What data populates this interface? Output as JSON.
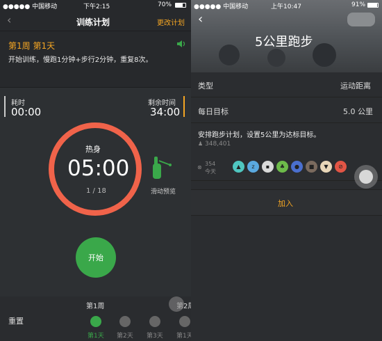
{
  "left": {
    "status": {
      "carrier": "●●●●● 中国移动",
      "time": "下午2:15",
      "battery": "70%"
    },
    "nav": {
      "title": "训练计划",
      "action": "更改计划"
    },
    "plan": {
      "week_day": "第1周 第1天",
      "desc": "开始训练，慢跑1分钟+步行2分钟，重复8次。"
    },
    "timers": {
      "elapsed_label": "耗时",
      "elapsed_value": "00:00",
      "remaining_label": "剩余时间",
      "remaining_value": "34:00"
    },
    "ring": {
      "phase": "热身",
      "time": "05:00",
      "counter": "1 / 18"
    },
    "swipe": {
      "label": "滑动预览"
    },
    "start_label": "开始",
    "reset_label": "重置",
    "weeks": {
      "w1": "第1周",
      "w2": "第2周"
    },
    "days": [
      "第1天",
      "第2天",
      "第3天",
      "第1天"
    ],
    "colors": {
      "accent": "#f5a623",
      "ring": "#f0634a",
      "start": "#3aa84a"
    }
  },
  "right": {
    "status": {
      "carrier": "●●●●● 中国移动",
      "time": "上午10:47",
      "battery": "91%"
    },
    "hero_title": "5公里跑步",
    "rows": [
      {
        "label": "类型",
        "value": "运动距离"
      },
      {
        "label": "每日目标",
        "value": "5.0 公里"
      }
    ],
    "desc": "安排跑步计划，设置5公里为达标目标。",
    "participants": "348,401",
    "today_count": "354",
    "today_label": "今天",
    "add_label": "加入",
    "activity_icons": [
      "running-icon",
      "sleep-icon",
      "scale-icon",
      "plant-icon",
      "bottle-icon",
      "game-icon",
      "icecream-icon",
      "no-smoking-icon"
    ]
  }
}
